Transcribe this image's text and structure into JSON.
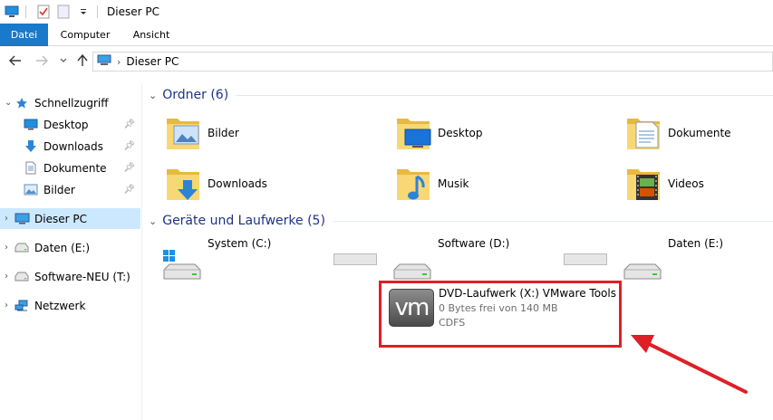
{
  "window": {
    "title": "Dieser PC"
  },
  "ribbon": {
    "tabs": [
      {
        "label": "Datei"
      },
      {
        "label": "Computer"
      },
      {
        "label": "Ansicht"
      }
    ]
  },
  "address": {
    "crumbs": [
      {
        "label": "Dieser PC"
      }
    ]
  },
  "sidebar": {
    "items": [
      {
        "label": "Schnellzugriff",
        "icon": "star-icon"
      },
      {
        "label": "Desktop",
        "icon": "desktop-icon",
        "pinned": true
      },
      {
        "label": "Downloads",
        "icon": "download-icon",
        "pinned": true
      },
      {
        "label": "Dokumente",
        "icon": "document-icon",
        "pinned": true
      },
      {
        "label": "Bilder",
        "icon": "pictures-icon",
        "pinned": true
      },
      {
        "label": "Dieser PC",
        "icon": "computer-icon",
        "selected": true
      },
      {
        "label": "Daten (E:)",
        "icon": "drive-icon"
      },
      {
        "label": "Software-NEU (T:)",
        "icon": "drive-icon"
      },
      {
        "label": "Netzwerk",
        "icon": "network-icon"
      }
    ]
  },
  "main": {
    "folders_header": "Ordner (6)",
    "folders": [
      {
        "label": "Bilder",
        "icon": "pictures-folder-icon"
      },
      {
        "label": "Desktop",
        "icon": "desktop-folder-icon"
      },
      {
        "label": "Dokumente",
        "icon": "documents-folder-icon"
      },
      {
        "label": "Downloads",
        "icon": "downloads-folder-icon"
      },
      {
        "label": "Musik",
        "icon": "music-folder-icon"
      },
      {
        "label": "Videos",
        "icon": "videos-folder-icon"
      }
    ],
    "drives_header": "Geräte und Laufwerke (5)",
    "drives": [
      {
        "label": "System (C:)",
        "icon": "windows-drive-icon"
      },
      {
        "label": "Software (D:)",
        "icon": "drive-icon"
      },
      {
        "label": "Daten (E:)",
        "icon": "drive-icon"
      }
    ],
    "dvd": {
      "label": "DVD-Laufwerk (X:) VMware Tools",
      "free": "0 Bytes frei von 140 MB",
      "filesystem": "CDFS",
      "logo_text": "vm",
      "highlight_color": "#e01e26"
    }
  },
  "colors": {
    "accent": "#1979ca",
    "selection": "#cce8ff",
    "header_text": "#1e3287",
    "annotation": "#e01e26"
  }
}
